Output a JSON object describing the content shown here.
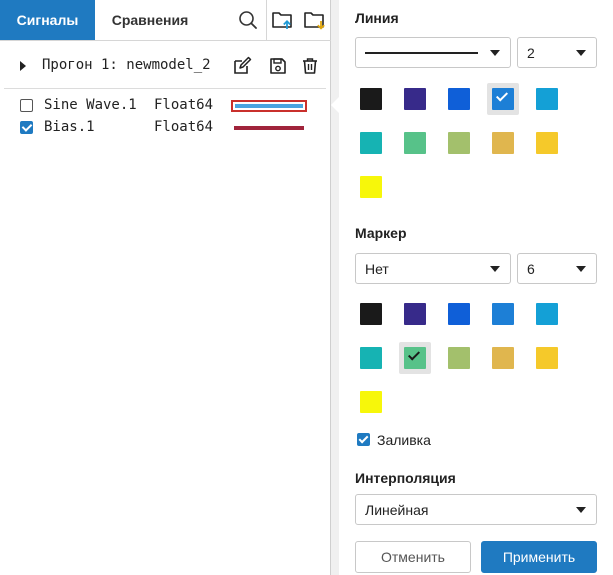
{
  "tabs": [
    {
      "label": "Сигналы",
      "active": true
    },
    {
      "label": "Сравнения",
      "active": false
    }
  ],
  "toolbar_icons": [
    "search-icon",
    "folder-upload-icon",
    "folder-download-icon"
  ],
  "run": {
    "label": "Прогон 1: newmodel_2",
    "actions": [
      "edit-icon",
      "save-icon",
      "trash-icon"
    ]
  },
  "signals": [
    {
      "name": "Sine Wave.1",
      "type": "Float64",
      "checked": false,
      "line_color": "#4aa3df",
      "selected": true
    },
    {
      "name": "Bias.1",
      "type": "Float64",
      "checked": true,
      "line_color": "#a0243b",
      "selected": false
    }
  ],
  "line_section": {
    "title": "Линия",
    "style_value": "",
    "width_value": "2"
  },
  "marker_section": {
    "title": "Маркер",
    "type_value": "Нет",
    "size_value": "6"
  },
  "palette": [
    "#1a1a1a",
    "#372a8a",
    "#0f5fd8",
    "#1d7fd6",
    "#14a0d6",
    "#16b3b3",
    "#57c289",
    "#a3c06c",
    "#e0b64e",
    "#f5c92a",
    "#f7f70a"
  ],
  "line_selected_index": 3,
  "marker_selected_index": 6,
  "fill": {
    "label": "Заливка",
    "checked": true
  },
  "interpolation": {
    "title": "Интерполяция",
    "value": "Линейная"
  },
  "buttons": {
    "cancel": "Отменить",
    "apply": "Применить"
  },
  "colors": {
    "accent": "#1f7ac1",
    "selection_red": "#c9302c"
  }
}
